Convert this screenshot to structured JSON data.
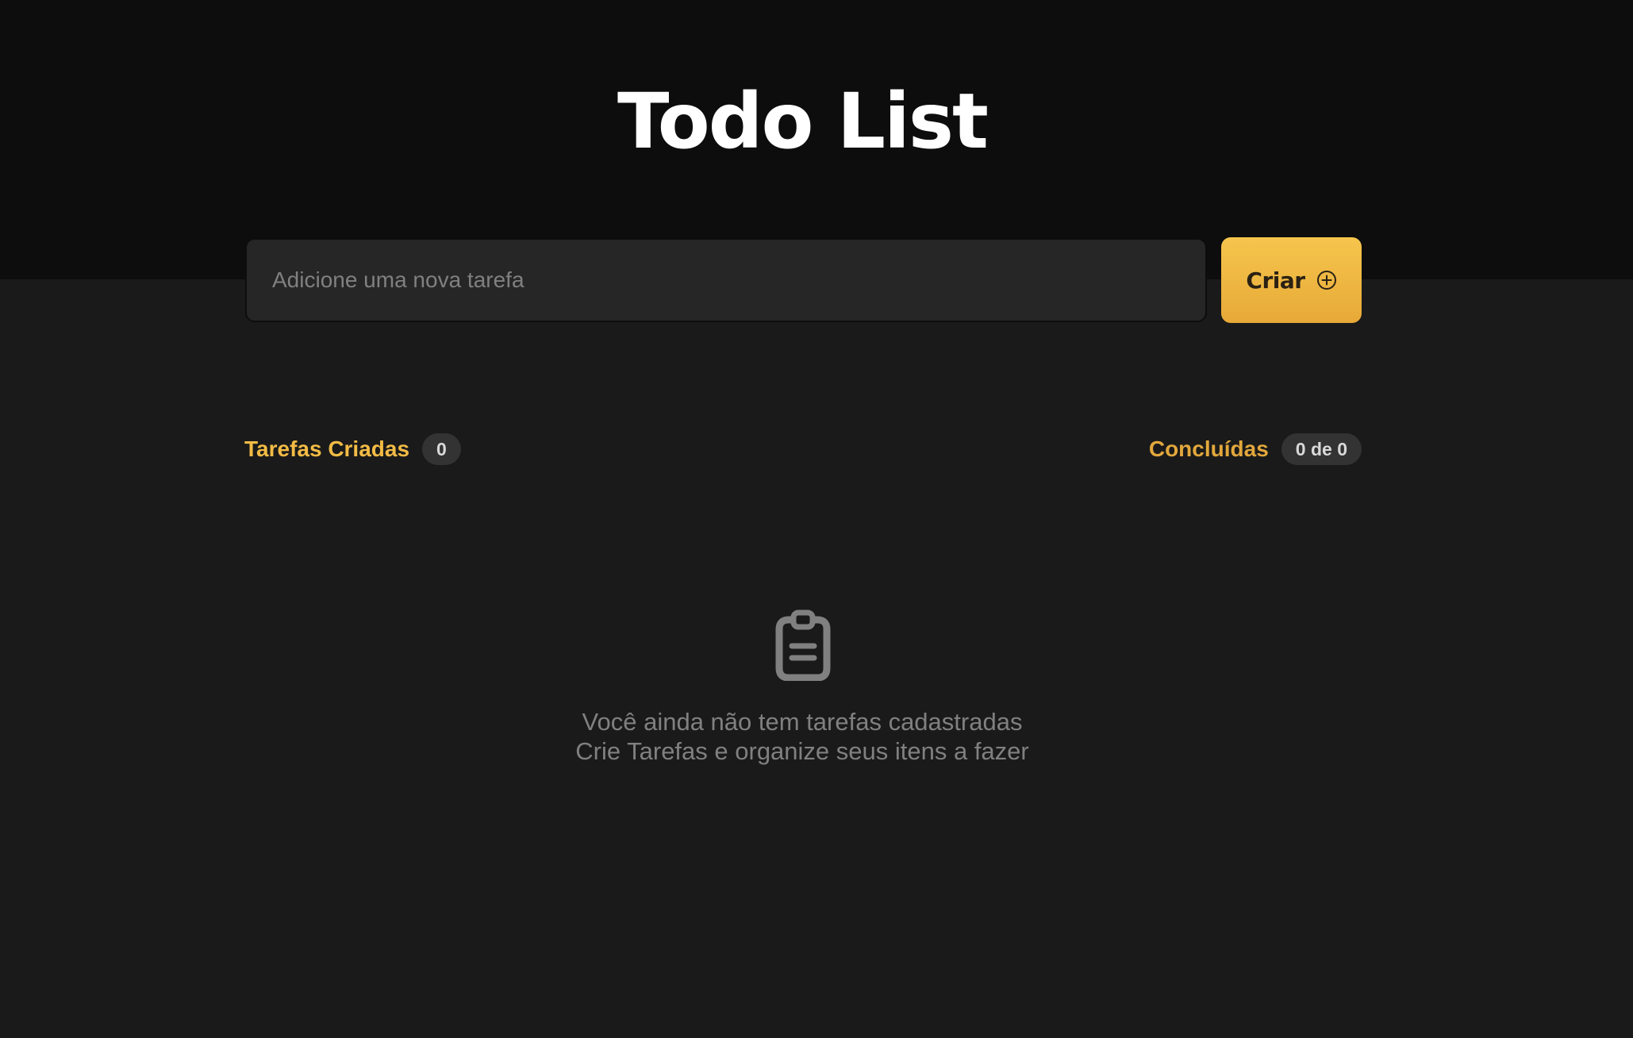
{
  "header": {
    "title": "Todo List"
  },
  "new_task": {
    "placeholder": "Adicione uma nova tarefa",
    "value": "",
    "create_label": "Criar",
    "create_icon": "plus-circle-icon"
  },
  "stats": {
    "created_label": "Tarefas Criadas",
    "created_count": "0",
    "done_label": "Concluídas",
    "done_count": "0 de 0"
  },
  "empty_state": {
    "icon": "clipboard-icon",
    "line1": "Você ainda não tem tarefas cadastradas",
    "line2": "Crie Tarefas e organize seus itens a fazer"
  },
  "colors": {
    "accent": "#f2bb45",
    "header_bg": "#0d0d0d",
    "page_bg": "#1a1a1a",
    "input_bg": "#262626",
    "muted_text": "#808080"
  }
}
